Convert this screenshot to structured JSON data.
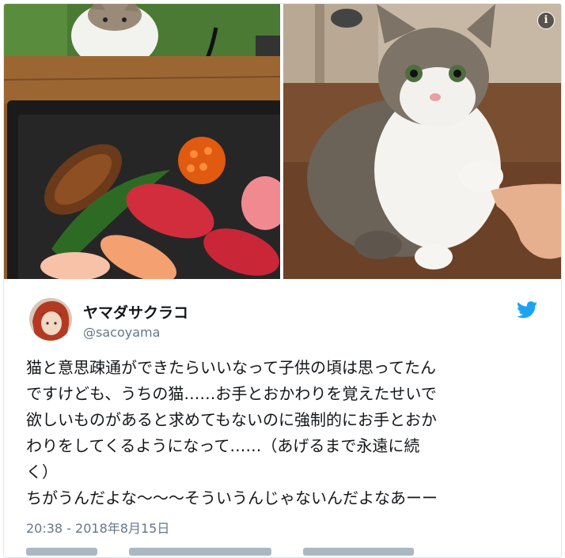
{
  "tweet": {
    "display_name": "ヤマダサクラコ",
    "handle": "@sacoyama",
    "text_lines": [
      "猫と意思疎通ができたらいいなって子供の頃は思ってたん",
      "ですけども、うちの猫……お手とおかわりを覚えたせいで",
      "欲しいものがあると求めてもないのに強制的にお手とおか",
      "わりをしてくるようになって……（あげるまで永遠に続",
      "く）",
      "ちがうんだよな〜〜〜そういうんじゃないんだよなあーー"
    ],
    "timestamp": "20:38 - 2018年8月15日"
  },
  "icons": {
    "info": "info-icon",
    "twitter": "twitter-bird-icon",
    "avatar": "avatar"
  },
  "colors": {
    "twitter_blue": "#1da1f2",
    "text": "#14171a",
    "secondary_text": "#657786",
    "border": "#e1e8ed"
  }
}
